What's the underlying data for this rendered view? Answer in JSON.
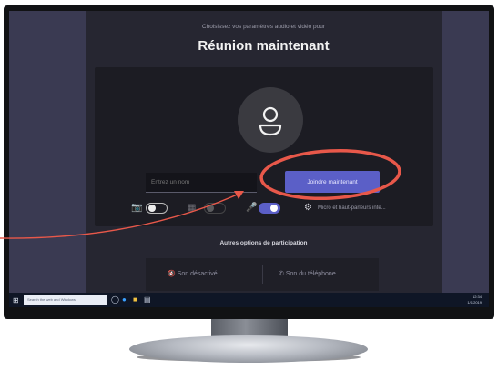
{
  "prejoin": {
    "subtitle": "Choisissez vos paramètres audio et vidéo pour",
    "title": "Réunion maintenant",
    "name_placeholder": "Entrez un nom",
    "join_label": "Joindre maintenant",
    "speaker_label": "Micro et haut-parleurs inte...",
    "other_options_title": "Autres options de participation",
    "option_audio_off": "Son désactivé",
    "option_phone": "Son du téléphone"
  },
  "toggles": {
    "camera": "off",
    "blur": "off",
    "microphone": "on"
  },
  "taskbar": {
    "search_placeholder": "Search the web and Windows",
    "time": "12:34",
    "date": "1/1/2019"
  },
  "annotations": {
    "highlight_color": "#e8584a",
    "target": "Joindre maintenant"
  },
  "colors": {
    "accent": "#5b5fc7",
    "background": "#262631"
  }
}
